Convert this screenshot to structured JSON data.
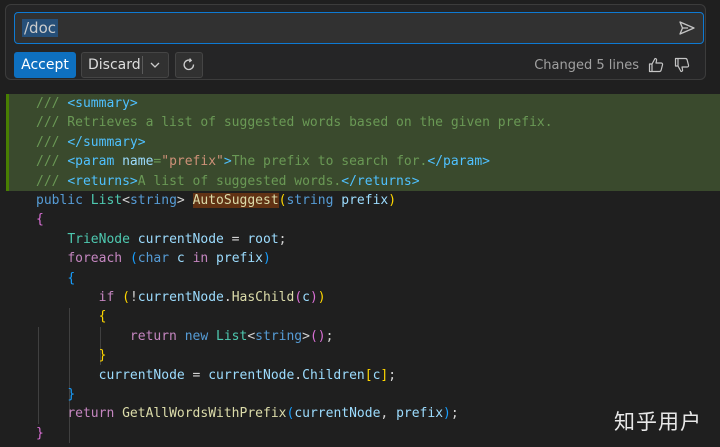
{
  "chat": {
    "prompt": "/doc",
    "accept_label": "Accept",
    "discard_label": "Discard",
    "changed_text": "Changed 5 lines"
  },
  "icons": {
    "send": "send-icon",
    "chevron": "chevron-down-icon",
    "regenerate": "refresh-icon",
    "thumbs_up": "thumbs-up-icon",
    "thumbs_down": "thumbs-down-icon"
  },
  "colors": {
    "accent": "#0e70c0",
    "added_line_bg": "#3a4a2d",
    "editor_bg": "#1f1f1f"
  },
  "watermark": "知乎用户",
  "code": {
    "l1": "/// <summary>",
    "l2": "/// Retrieves a list of suggested words based on the given prefix.",
    "l3": "/// </summary>",
    "l4": "/// <param name=\"prefix\">The prefix to search for.</param>",
    "l5": "/// <returns>A list of suggested words.</returns>",
    "l6": "public List<string> AutoSuggest(string prefix)",
    "l7": "{",
    "l8": "    TrieNode currentNode = root;",
    "l9": "    foreach (char c in prefix)",
    "l10": "    {",
    "l11": "        if (!currentNode.HasChild(c))",
    "l12": "        {",
    "l13": "            return new List<string>();",
    "l14": "        }",
    "l15": "        currentNode = currentNode.Children[c];",
    "l16": "    }",
    "l17": "    return GetAllWordsWithPrefix(currentNode, prefix);",
    "l18": "}"
  }
}
